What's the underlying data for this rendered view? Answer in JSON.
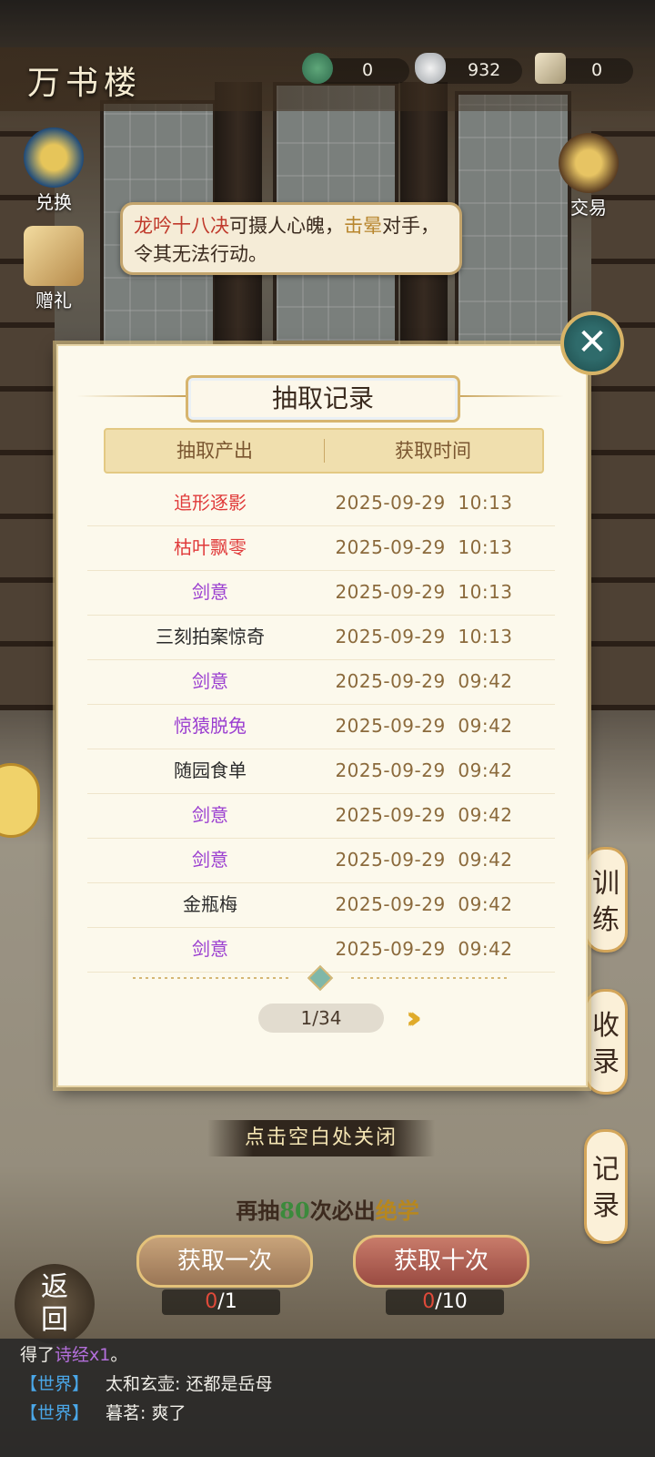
{
  "header": {
    "title": "万书楼"
  },
  "resources": [
    {
      "icon": "jade-toad-icon",
      "value": "0"
    },
    {
      "icon": "silver-ingot-icon",
      "value": "932"
    },
    {
      "icon": "book-ticket-icon",
      "value": "0"
    }
  ],
  "side_left": {
    "exchange": "兑换",
    "gift": "赠礼"
  },
  "side_right": {
    "trade": "交易"
  },
  "speech": {
    "skill": "龙吟十八决",
    "text1": "可摄人心魄，",
    "hit": "击晕",
    "text2": "对手，令其无法行动。"
  },
  "right_tabs": {
    "train": "训练",
    "collect": "收录",
    "record": "记录"
  },
  "dialog": {
    "title": "抽取记录",
    "col_item": "抽取产出",
    "col_time": "获取时间",
    "rows": [
      {
        "item": "追形逐影",
        "time": "2025-09-29  10:13",
        "rarity": "red"
      },
      {
        "item": "枯叶飘零",
        "time": "2025-09-29  10:13",
        "rarity": "red"
      },
      {
        "item": "剑意",
        "time": "2025-09-29  10:13",
        "rarity": "purple"
      },
      {
        "item": "三刻拍案惊奇",
        "time": "2025-09-29  10:13",
        "rarity": "black"
      },
      {
        "item": "剑意",
        "time": "2025-09-29  09:42",
        "rarity": "purple"
      },
      {
        "item": "惊猿脱兔",
        "time": "2025-09-29  09:42",
        "rarity": "purple"
      },
      {
        "item": "随园食单",
        "time": "2025-09-29  09:42",
        "rarity": "black"
      },
      {
        "item": "剑意",
        "time": "2025-09-29  09:42",
        "rarity": "purple"
      },
      {
        "item": "剑意",
        "time": "2025-09-29  09:42",
        "rarity": "purple"
      },
      {
        "item": "金瓶梅",
        "time": "2025-09-29  09:42",
        "rarity": "black"
      },
      {
        "item": "剑意",
        "time": "2025-09-29  09:42",
        "rarity": "purple"
      }
    ],
    "page": "1/34",
    "colors": {
      "red": "#e03a3a",
      "purple": "#9b3fd0",
      "black": "#2b2b2b"
    }
  },
  "hint": {
    "close": "点击空白处关闭"
  },
  "pity": {
    "prefix": "再抽",
    "count": "80",
    "mid": "次必出",
    "suffix": "绝学"
  },
  "draw": {
    "once": "获取一次",
    "ten": "获取十次",
    "once_have": "0",
    "once_need": "/1",
    "ten_have": "0",
    "ten_need": "/10"
  },
  "back": {
    "label1": "返",
    "label2": "回"
  },
  "chat": {
    "line1_prefix": "得了",
    "line1_item": "诗经x1",
    "line1_suffix": "。",
    "line2_tag": "【世界】",
    "line2_text": "太和玄壶: 还都是岳母",
    "line3_tag": "【世界】",
    "line3_text": "暮茗: 爽了"
  }
}
